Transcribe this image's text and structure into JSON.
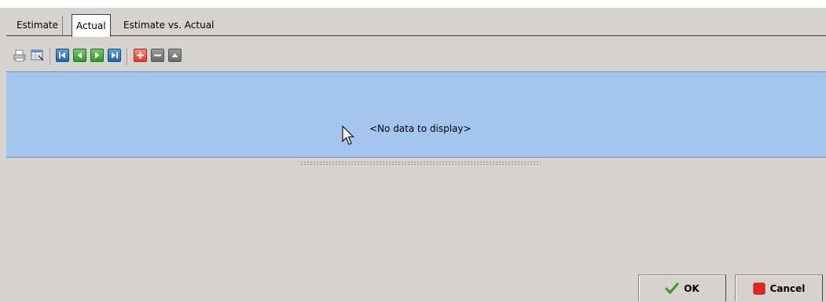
{
  "tabs": [
    {
      "label": "Estimate"
    },
    {
      "label": "Actual"
    },
    {
      "label": "Estimate vs. Actual"
    }
  ],
  "active_tab": "Actual",
  "toolbar": {
    "buttons": [
      "print-icon",
      "column-chooser-icon",
      "first-record-icon",
      "previous-record-icon",
      "next-record-icon",
      "last-record-icon",
      "add-icon",
      "remove-icon",
      "move-up-icon"
    ]
  },
  "grid": {
    "empty_text": "<No data to display>"
  },
  "buttons": {
    "ok_label": "OK",
    "cancel_label": "Cancel"
  }
}
